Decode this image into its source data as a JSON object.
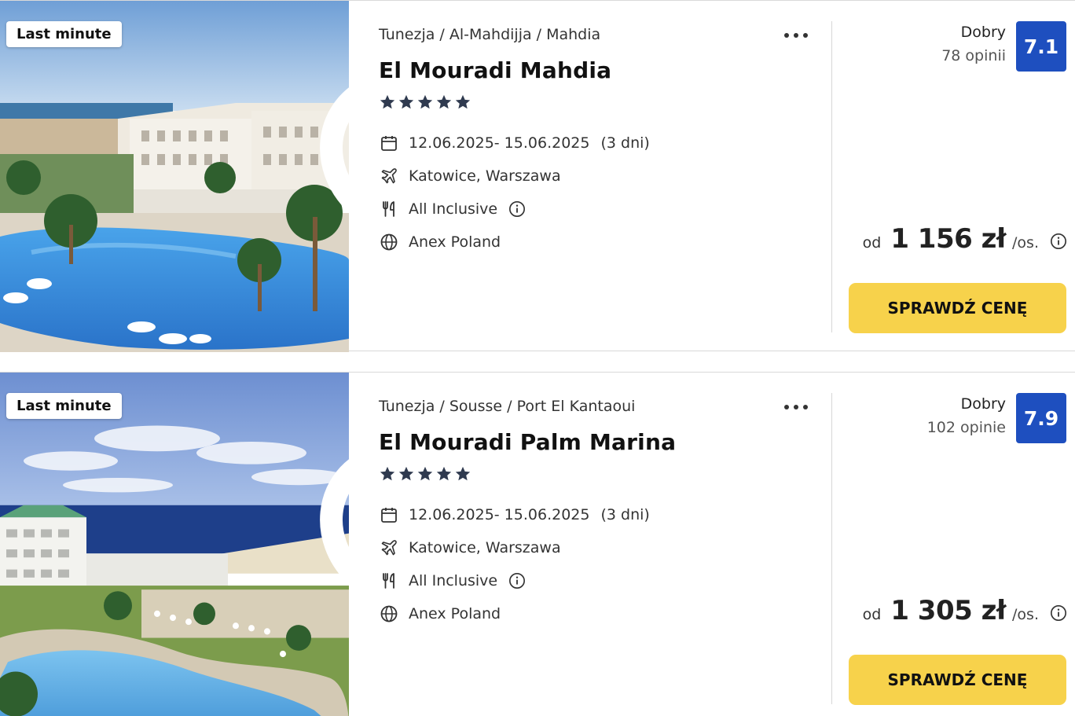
{
  "offers": [
    {
      "badge": "Last minute",
      "breadcrumb": "Tunezja / Al-Mahdijja / Mahdia",
      "hotel_name": "El Mouradi Mahdia",
      "stars": 5,
      "dates": "12.06.2025- 15.06.2025",
      "duration": "(3 dni)",
      "departure": "Katowice, Warszawa",
      "board": "All Inclusive",
      "operator": "Anex Poland",
      "rating_label": "Dobry",
      "reviews": "78 opinii",
      "score": "7.1",
      "price_prefix": "od",
      "price": "1 156 zł",
      "price_suffix": "/os.",
      "cta": "SPRAWDŹ CENĘ"
    },
    {
      "badge": "Last minute",
      "breadcrumb": "Tunezja / Sousse / Port El Kantaoui",
      "hotel_name": "El Mouradi Palm Marina",
      "stars": 5,
      "dates": "12.06.2025- 15.06.2025",
      "duration": "(3 dni)",
      "departure": "Katowice, Warszawa",
      "board": "All Inclusive",
      "operator": "Anex Poland",
      "rating_label": "Dobry",
      "reviews": "102 opinie",
      "score": "7.9",
      "price_prefix": "od",
      "price": "1 305 zł",
      "price_suffix": "/os.",
      "cta": "SPRAWDŹ CENĘ"
    }
  ],
  "colors": {
    "score_bg": "#1e4fbf",
    "cta_bg": "#f7d24b",
    "star": "#2f3a4f"
  },
  "icons": [
    "heart-icon",
    "calendar-icon",
    "plane-icon",
    "cutlery-icon",
    "info-icon",
    "globe-icon",
    "more-dots-icon",
    "star-icon"
  ]
}
